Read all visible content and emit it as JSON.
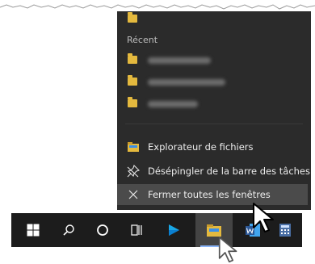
{
  "jump_list": {
    "pinned_items": [
      {
        "icon": "folder-icon"
      }
    ],
    "section_recent": "Récent",
    "recent_items": [
      {
        "icon": "folder-icon"
      },
      {
        "icon": "folder-icon"
      },
      {
        "icon": "folder-icon"
      }
    ],
    "actions": [
      {
        "label": "Explorateur de fichiers",
        "icon": "file-explorer-icon"
      },
      {
        "label": "Désépingler de la barre des tâches",
        "icon": "unpin-icon"
      },
      {
        "label": "Fermer toutes les fenêtres",
        "icon": "close-icon",
        "highlighted": true
      }
    ]
  },
  "taskbar": {
    "buttons": [
      {
        "name": "start",
        "icon": "windows-logo-icon"
      },
      {
        "name": "search",
        "icon": "search-icon"
      },
      {
        "name": "cortana",
        "icon": "cortana-circle-icon"
      },
      {
        "name": "task-view",
        "icon": "task-view-icon"
      },
      {
        "name": "media-player",
        "icon": "play-icon"
      },
      {
        "name": "file-explorer",
        "icon": "file-explorer-icon",
        "active": true
      },
      {
        "name": "word",
        "icon": "word-icon"
      },
      {
        "name": "calculator",
        "icon": "calculator-icon"
      }
    ]
  },
  "colors": {
    "jumplist_bg": "#2b2b2b",
    "taskbar_bg": "#1c1c1c",
    "folder_yellow": "#e4b93e",
    "highlight": "#4b4b4b",
    "word_blue": "#2b5797"
  }
}
